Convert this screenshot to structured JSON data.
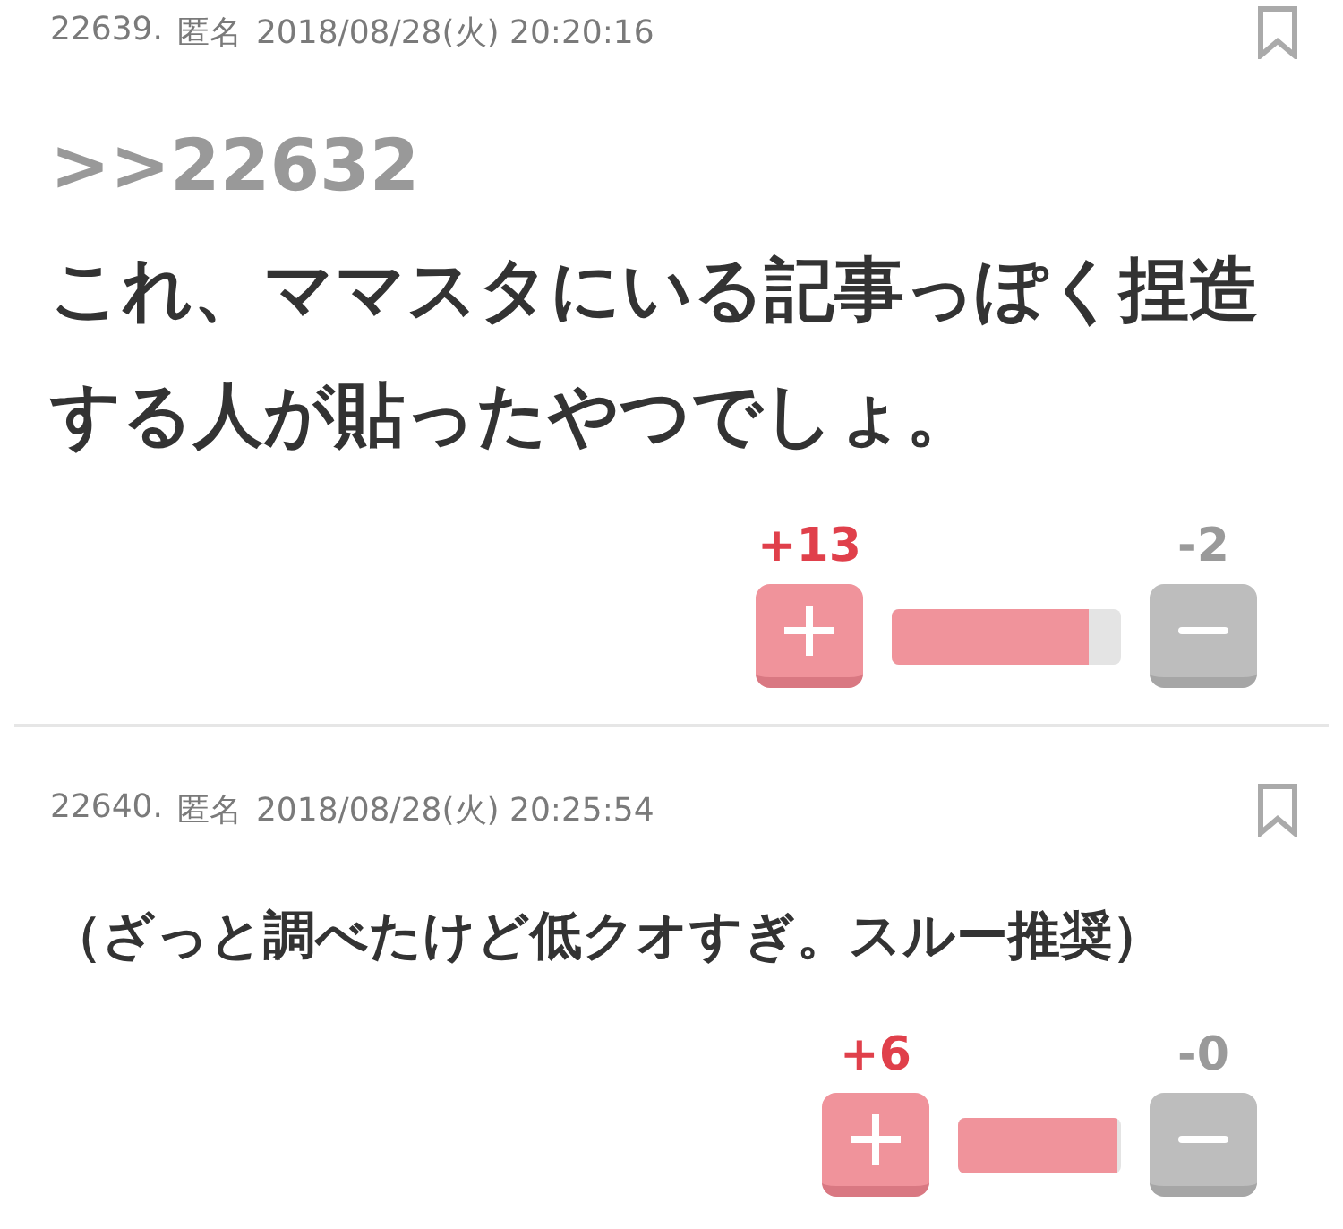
{
  "posts": [
    {
      "number": "22639.",
      "author": "匿名",
      "datetime": "2018/08/28(火) 20:20:16",
      "bookmarked": false,
      "reply_to": ">>22632",
      "body": "これ、ママスタにいる記事っぽく捏造する人が貼ったやつでしょ。",
      "plus_count": "+13",
      "minus_count": "-2",
      "level": 0.86
    },
    {
      "number": "22640.",
      "author": "匿名",
      "datetime": "2018/08/28(火) 20:25:54",
      "bookmarked": false,
      "body": "（ざっと調べたけど低クオすぎ。スルー推奨）",
      "plus_count": "+6",
      "minus_count": "-0",
      "level": 0.98
    }
  ]
}
